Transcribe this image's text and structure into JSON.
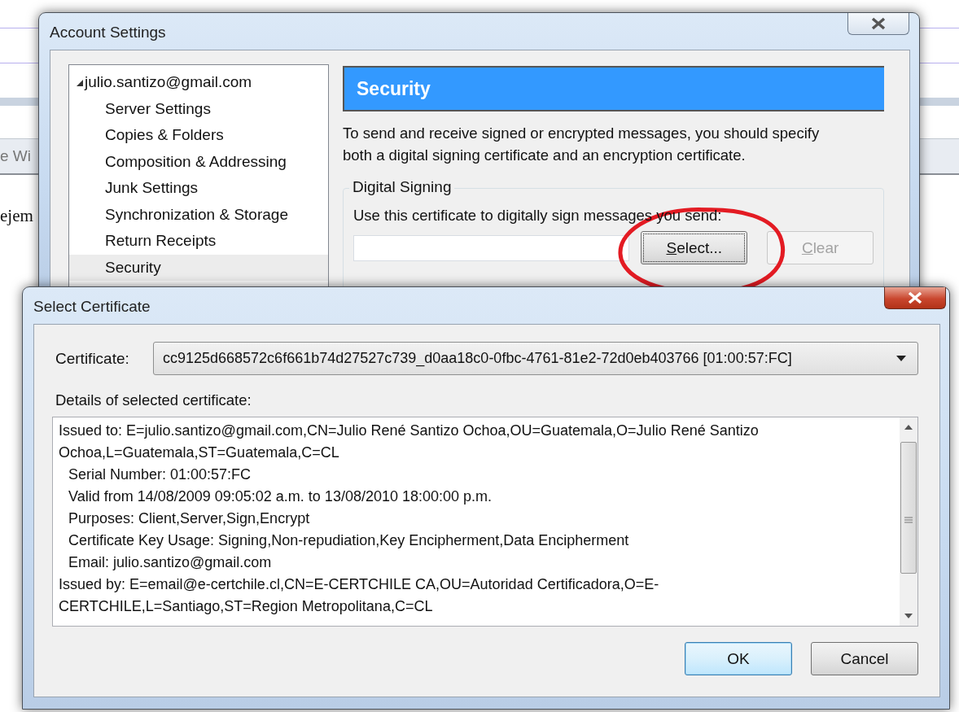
{
  "background": {
    "tab_text": "e Wi",
    "body_text": "ejem"
  },
  "account_settings": {
    "title": "Account Settings",
    "tree": [
      {
        "label": "julio.santizo@gmail.com",
        "expanded": true,
        "selected": false,
        "children": [
          {
            "label": "Server Settings",
            "selected": false
          },
          {
            "label": "Copies & Folders",
            "selected": false
          },
          {
            "label": "Composition & Addressing",
            "selected": false
          },
          {
            "label": "Junk Settings",
            "selected": false
          },
          {
            "label": "Synchronization & Storage",
            "selected": false
          },
          {
            "label": "Return Receipts",
            "selected": false
          },
          {
            "label": "Security",
            "selected": true
          }
        ]
      }
    ],
    "header": "Security",
    "description": "To send and receive signed or encrypted messages, you should specify both a digital signing certificate and an encryption certificate.",
    "group": {
      "legend": "Digital Signing",
      "label": "Use this certificate to digitally sign messages you send:",
      "buttons": [
        {
          "label": "Select...",
          "disabled": false,
          "focused": true
        },
        {
          "label": "Clear",
          "disabled": true,
          "focused": false
        }
      ]
    }
  },
  "select_certificate": {
    "title": "Select Certificate",
    "certificate_label": "Certificate:",
    "certificate_value": "cc9125d668572c6f661b74d27527c739_d0aa18c0-0fbc-4761-81e2-72d0eb403766 [01:00:57:FC]",
    "details_label": "Details of selected certificate:",
    "details": [
      {
        "text": "Issued to: E=julio.santizo@gmail.com,CN=Julio René Santizo Ochoa,OU=Guatemala,O=Julio René Santizo Ochoa,L=Guatemala,ST=Guatemala,C=CL",
        "indented": false
      },
      {
        "text": "Serial Number: 01:00:57:FC",
        "indented": true
      },
      {
        "text": "Valid from 14/08/2009 09:05:02 a.m. to 13/08/2010 18:00:00 p.m.",
        "indented": true
      },
      {
        "text": "Purposes: Client,Server,Sign,Encrypt",
        "indented": true
      },
      {
        "text": "Certificate Key Usage: Signing,Non-repudiation,Key Encipherment,Data Encipherment",
        "indented": true
      },
      {
        "text": "Email: julio.santizo@gmail.com",
        "indented": true
      },
      {
        "text": "Issued by: E=email@e-certchile.cl,CN=E-CERTCHILE CA,OU=Autoridad Certificadora,O=E-CERTCHILE,L=Santiago,ST=Region Metropolitana,C=CL",
        "indented": false
      }
    ],
    "buttons": [
      {
        "label": "OK",
        "default": true
      },
      {
        "label": "Cancel",
        "default": false
      }
    ]
  }
}
